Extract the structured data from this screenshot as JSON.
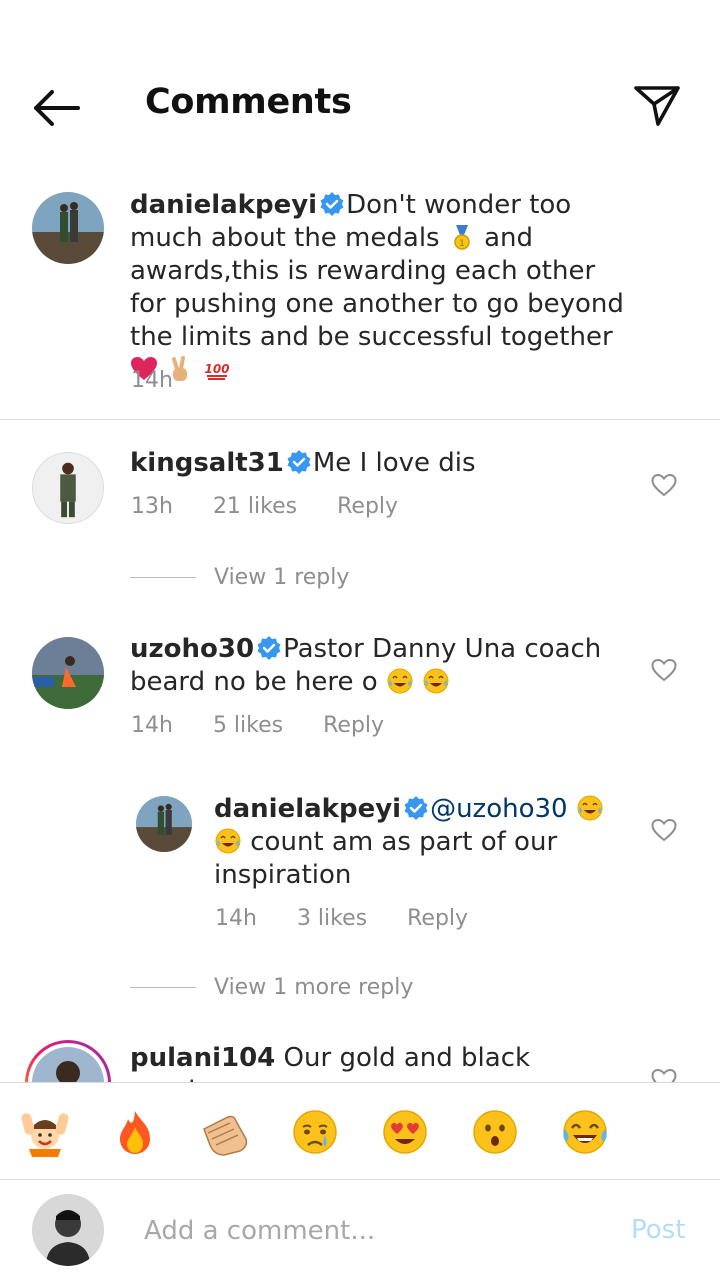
{
  "header": {
    "title": "Comments",
    "back_icon": "arrow-left-icon",
    "share_icon": "paper-plane-icon"
  },
  "caption": {
    "username": "danielakpeyi",
    "text_1": "Don't wonder too much about the medals",
    "text_2": " and awards,this is rewarding each other for pushing one another to go beyond the limits and be successful together",
    "time": "14h"
  },
  "comments": [
    {
      "username": "kingsalt31",
      "text": "Me I love dis",
      "time": "13h",
      "likes": "21 likes",
      "reply": "Reply",
      "view_replies": "View 1 reply"
    },
    {
      "username": "uzoho30",
      "text": "Pastor Danny Una coach beard no be here o",
      "time": "14h",
      "likes": "5 likes",
      "reply": "Reply",
      "reply_item": {
        "username": "danielakpeyi",
        "mention": "@uzoho30",
        "text": "count am as part of our inspiration",
        "time": "14h",
        "likes": "3 likes",
        "reply": "Reply"
      },
      "view_replies": "View 1 more reply"
    },
    {
      "username": "pulani104",
      "text": "Our gold and black warriors"
    }
  ],
  "reactions": [
    "raising-hands-emoji",
    "fire-emoji",
    "clapping-hands-emoji",
    "crying-face-emoji",
    "heart-eyes-emoji",
    "surprised-face-emoji",
    "tears-of-joy-emoji"
  ],
  "composer": {
    "placeholder": "Add a comment...",
    "post_label": "Post"
  },
  "colors": {
    "verified": "#3897f0",
    "muted": "#8e8e8e",
    "post_disabled": "#b3dbff",
    "heart_red": "#e0245e"
  }
}
